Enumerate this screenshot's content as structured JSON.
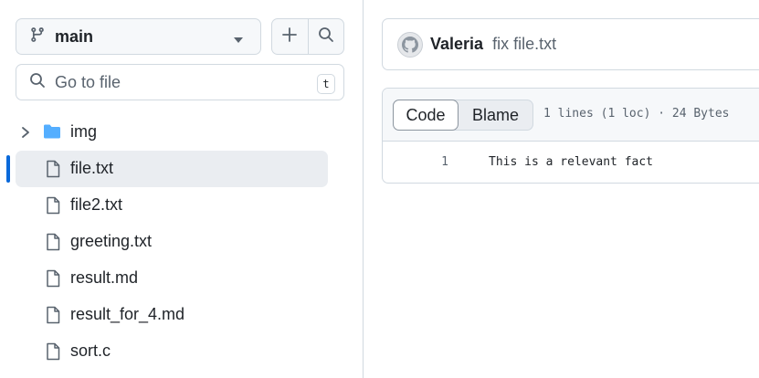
{
  "sidebar": {
    "branch": {
      "label": "main"
    },
    "goto": {
      "placeholder": "Go to file",
      "shortcut": "t"
    },
    "tree": [
      {
        "type": "folder",
        "label": "img",
        "expanded": false,
        "selected": false
      },
      {
        "type": "file",
        "label": "file.txt",
        "selected": true
      },
      {
        "type": "file",
        "label": "file2.txt",
        "selected": false
      },
      {
        "type": "file",
        "label": "greeting.txt",
        "selected": false
      },
      {
        "type": "file",
        "label": "result.md",
        "selected": false
      },
      {
        "type": "file",
        "label": "result_for_4.md",
        "selected": false
      },
      {
        "type": "file",
        "label": "sort.c",
        "selected": false
      }
    ]
  },
  "commit": {
    "author": "Valeria",
    "message": "fix file.txt"
  },
  "file_view": {
    "tabs": {
      "code": "Code",
      "blame": "Blame"
    },
    "meta": "1 lines (1 loc) · 24 Bytes",
    "lines": [
      {
        "number": "1",
        "text": "This is a relevant fact"
      }
    ]
  },
  "colors": {
    "accent": "#0969da",
    "folder": "#54aeff",
    "selected_bg": "#eaedf1",
    "border": "#d1d9e0"
  },
  "icons": [
    "git-branch-icon",
    "caret-down-icon",
    "plus-icon",
    "search-icon",
    "chevron-right-icon",
    "folder-icon",
    "file-icon",
    "avatar-icon"
  ]
}
